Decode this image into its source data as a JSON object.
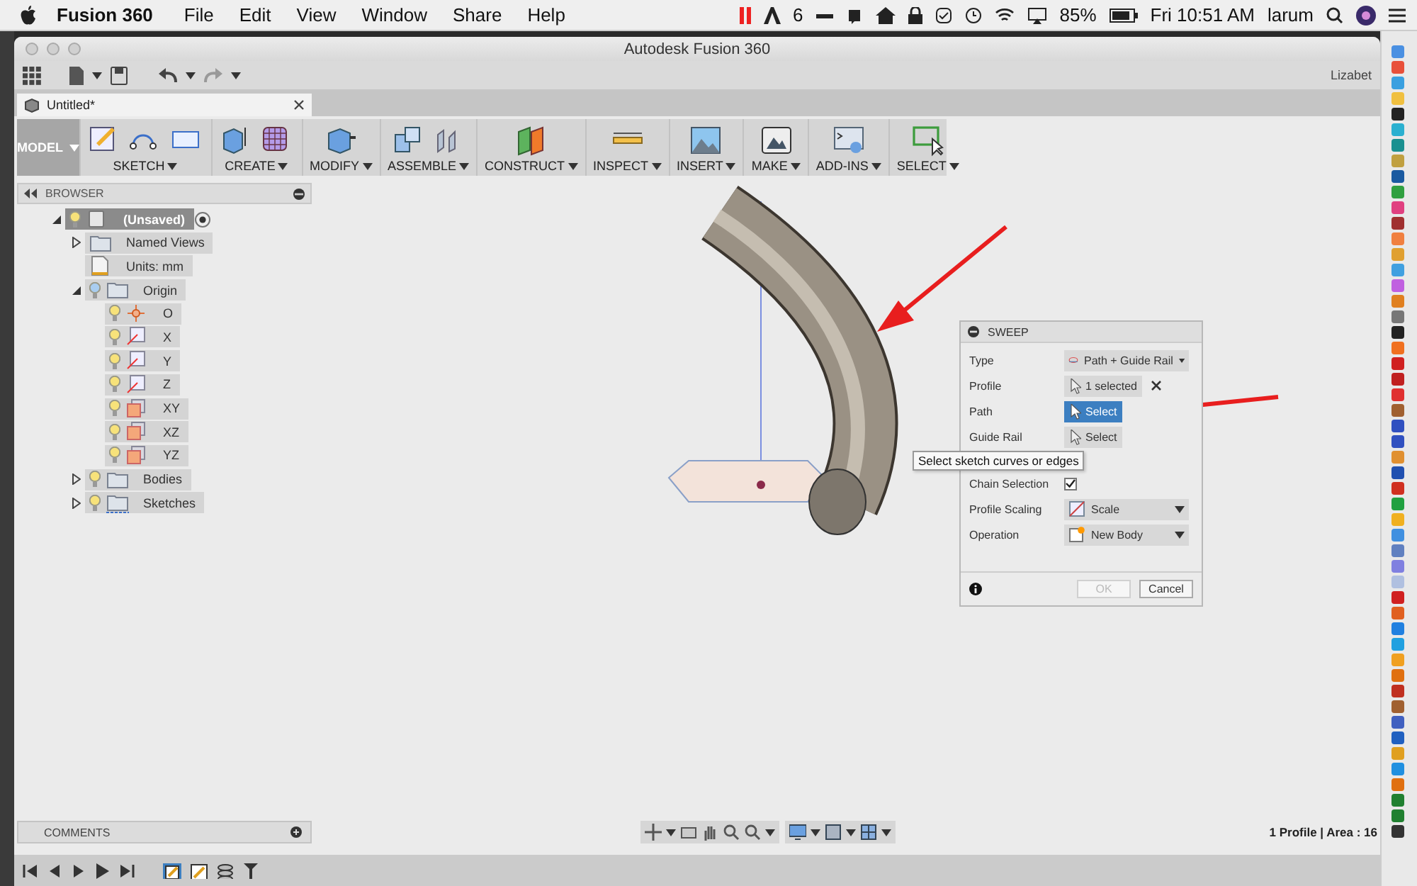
{
  "menu_bar": {
    "app_name": "Fusion 360",
    "menus": [
      "File",
      "Edit",
      "View",
      "Window",
      "Share",
      "Help"
    ],
    "status_items": [
      "6",
      "85%",
      "Fri 10:51 AM",
      "larum"
    ]
  },
  "window": {
    "title": "Autodesk Fusion 360",
    "user": "Lizabet"
  },
  "document_tab": {
    "label": "Untitled*"
  },
  "ribbon": {
    "workspace": "MODEL",
    "groups": [
      {
        "label": "SKETCH"
      },
      {
        "label": "CREATE"
      },
      {
        "label": "MODIFY"
      },
      {
        "label": "ASSEMBLE"
      },
      {
        "label": "CONSTRUCT"
      },
      {
        "label": "INSPECT"
      },
      {
        "label": "INSERT"
      },
      {
        "label": "MAKE"
      },
      {
        "label": "ADD-INS"
      },
      {
        "label": "SELECT"
      }
    ]
  },
  "browser": {
    "title": "BROWSER",
    "tree": [
      {
        "label": "(Unsaved)",
        "kind": "component",
        "visible": true,
        "selected": true,
        "expanded": true,
        "children": [
          {
            "label": "Named Views",
            "kind": "folder",
            "selected": false,
            "expanded": false
          },
          {
            "label": "Units: mm",
            "kind": "units",
            "selected": false
          },
          {
            "label": "Origin",
            "kind": "folder",
            "visible": false,
            "selected": false,
            "expanded": true,
            "children": [
              {
                "label": "O",
                "kind": "point",
                "visible": true,
                "selected": false
              },
              {
                "label": "X",
                "kind": "axis",
                "visible": true,
                "selected": false
              },
              {
                "label": "Y",
                "kind": "axis",
                "visible": true,
                "selected": false
              },
              {
                "label": "Z",
                "kind": "axis",
                "visible": true,
                "selected": false
              },
              {
                "label": "XY",
                "kind": "plane",
                "visible": true,
                "selected": false
              },
              {
                "label": "XZ",
                "kind": "plane",
                "visible": true,
                "selected": false
              },
              {
                "label": "YZ",
                "kind": "plane",
                "visible": true,
                "selected": false
              }
            ]
          },
          {
            "label": "Bodies",
            "kind": "folder",
            "visible": true,
            "selected": false,
            "expanded": false
          },
          {
            "label": "Sketches",
            "kind": "sketches",
            "visible": true,
            "selected": false,
            "expanded": false
          }
        ]
      }
    ]
  },
  "sweep": {
    "title": "SWEEP",
    "rows": [
      {
        "label": "Type",
        "kind": "dropdown",
        "value": "Path + Guide Rail"
      },
      {
        "label": "Profile",
        "kind": "selection",
        "value": "1 selected",
        "active": false,
        "clearable": true
      },
      {
        "label": "Path",
        "kind": "selection",
        "value": "Select",
        "active": true
      },
      {
        "label": "Guide Rail",
        "kind": "selection",
        "value": "Select",
        "active": false
      },
      {
        "label": "Chain Selection",
        "kind": "checkbox",
        "checked": true
      },
      {
        "label": "Profile Scaling",
        "kind": "dropdown",
        "value": "Scale"
      },
      {
        "label": "Operation",
        "kind": "dropdown",
        "value": "New Body"
      }
    ],
    "buttons": [
      {
        "label": "OK",
        "disabled": true
      },
      {
        "label": "Cancel",
        "disabled": false
      }
    ],
    "tooltip": "Select sketch curves or edges"
  },
  "comments": {
    "title": "COMMENTS"
  },
  "status": "1 Profile | Area : 16"
}
